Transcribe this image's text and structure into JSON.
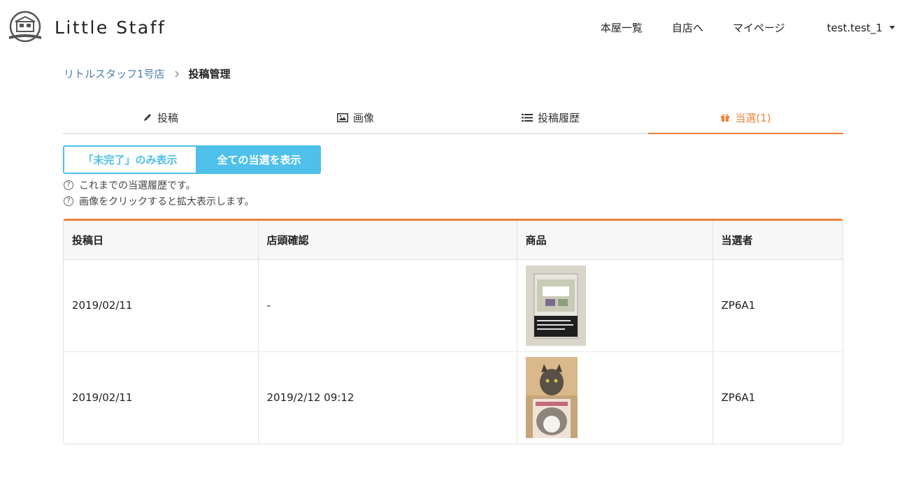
{
  "header": {
    "brand": "Little Staff",
    "nav": [
      "本屋一覧",
      "自店へ",
      "マイページ"
    ],
    "user": "test.test_1"
  },
  "breadcrumb": {
    "store": "リトルスタッフ1号店",
    "current": "投稿管理"
  },
  "tabs": [
    {
      "label": "投稿",
      "icon": "pencil-icon"
    },
    {
      "label": "画像",
      "icon": "image-icon"
    },
    {
      "label": "投稿履歴",
      "icon": "list-icon"
    },
    {
      "label": "当選(1)",
      "icon": "gift-icon",
      "active": true
    }
  ],
  "filters": {
    "incomplete_only": "「未完了」のみ表示",
    "show_all": "全ての当選を表示"
  },
  "hints": [
    "これまでの当選履歴です。",
    "画像をクリックすると拡大表示します。"
  ],
  "table": {
    "headers": [
      "投稿日",
      "店頭確認",
      "商品",
      "当選者"
    ],
    "rows": [
      {
        "date": "2019/02/11",
        "confirmed": "-",
        "product_image": "book-cover-image",
        "winner": "ZP6A1"
      },
      {
        "date": "2019/02/11",
        "confirmed": "2019/2/12 09:12",
        "product_image": "cat-photo-image",
        "winner": "ZP6A1"
      }
    ]
  },
  "colors": {
    "accent": "#ee7f3a",
    "button": "#4fc0ea",
    "link": "#4a7fb5"
  }
}
